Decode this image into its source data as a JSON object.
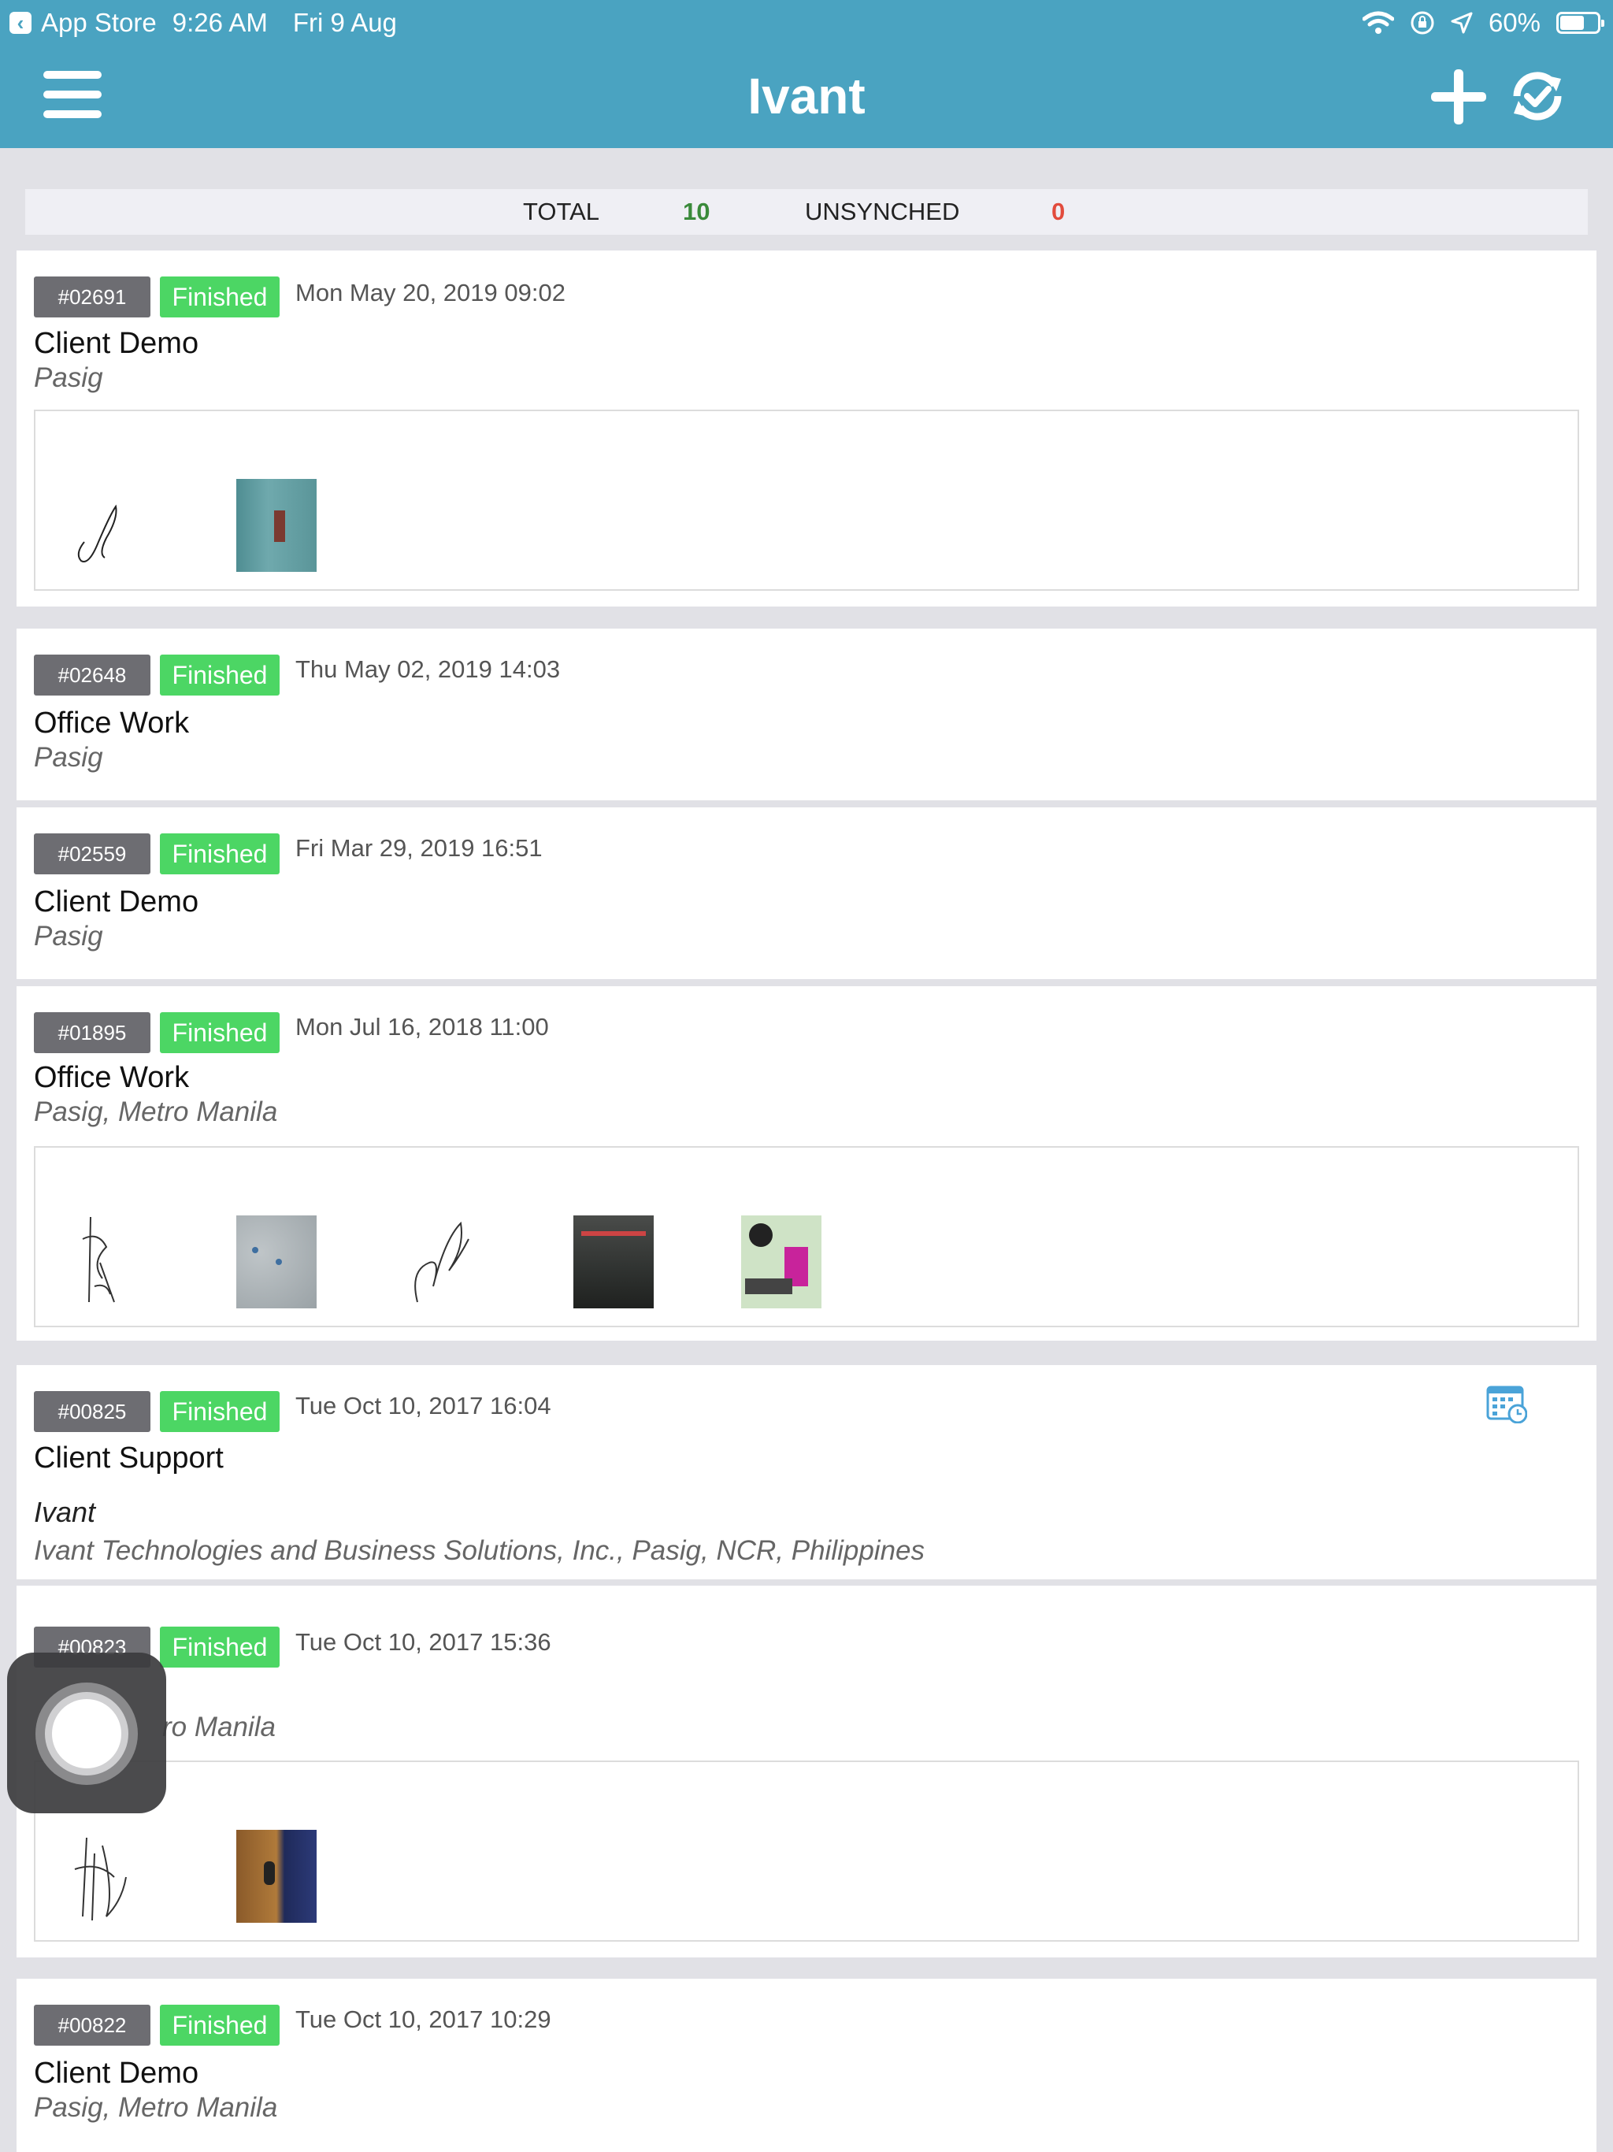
{
  "status_bar": {
    "back_app": "App Store",
    "time": "9:26 AM",
    "date": "Fri 9 Aug",
    "battery": "60%"
  },
  "header": {
    "title": "Ivant",
    "icons": [
      "hamburger-menu-icon",
      "plus-icon",
      "sync-icon"
    ]
  },
  "summary": {
    "total_label": "TOTAL",
    "total_value": "10",
    "unsynched_label": "UNSYNCHED",
    "unsynched_value": "0"
  },
  "colors": {
    "header": "#4aa3c1",
    "finished": "#4cd664",
    "id_tag": "#6d6d72",
    "total": "#3a8a3a",
    "unsynched": "#e24b3c"
  },
  "jobs": [
    {
      "id": "#02691",
      "status": "Finished",
      "date": "Mon May 20, 2019 09:02",
      "title": "Client Demo",
      "location": "Pasig"
    },
    {
      "id": "#02648",
      "status": "Finished",
      "date": "Thu May 02, 2019 14:03",
      "title": "Office Work",
      "location": "Pasig"
    },
    {
      "id": "#02559",
      "status": "Finished",
      "date": "Fri Mar 29, 2019 16:51",
      "title": "Client Demo",
      "location": "Pasig"
    },
    {
      "id": "#01895",
      "status": "Finished",
      "date": "Mon Jul 16, 2018 11:00",
      "title": "Office Work",
      "location": "Pasig, Metro Manila"
    },
    {
      "id": "#00825",
      "status": "Finished",
      "date": "Tue Oct 10, 2017 16:04",
      "title": "Client Support",
      "organization": "Ivant",
      "location": "Ivant Technologies and Business Solutions, Inc., Pasig, NCR, Philippines"
    },
    {
      "id": "#00823",
      "status": "Finished",
      "date": "Tue Oct 10, 2017 15:36",
      "location_partial": "ro Manila"
    },
    {
      "id": "#00822",
      "status": "Finished",
      "date": "Tue Oct 10, 2017 10:29",
      "title": "Client Demo",
      "location": "Pasig, Metro Manila"
    }
  ]
}
